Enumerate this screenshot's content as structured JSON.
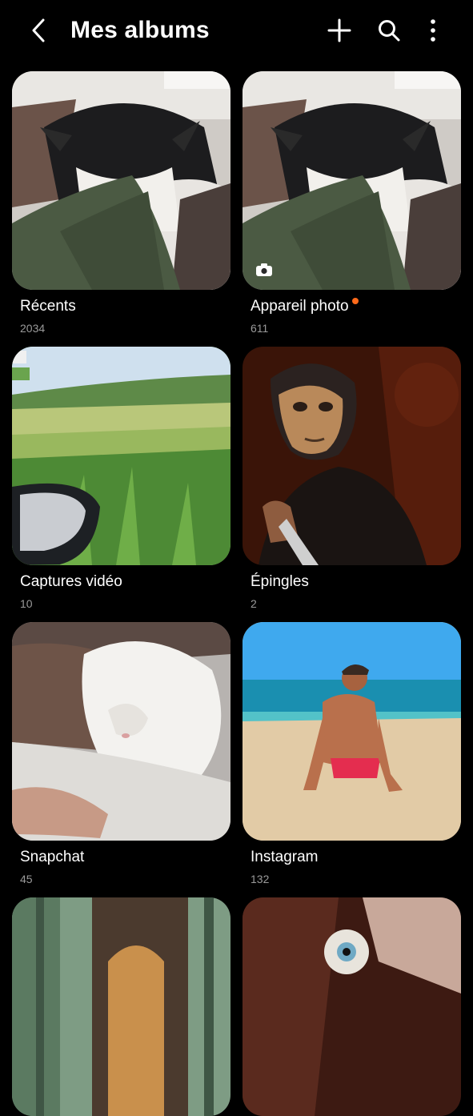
{
  "header": {
    "title": "Mes albums",
    "back_icon": "chevron-left-icon",
    "add_icon": "plus-icon",
    "search_icon": "search-icon",
    "more_icon": "more-vertical-icon"
  },
  "colors": {
    "background": "#000000",
    "text_primary": "#ffffff",
    "text_secondary": "#9a9a9a",
    "new_indicator": "#ff6a1a"
  },
  "albums": [
    {
      "name": "Récents",
      "count": "2034"
    },
    {
      "name": "Appareil photo",
      "count": "611",
      "badge_icon": "camera-icon",
      "has_new_indicator": true
    },
    {
      "name": "Captures vidéo",
      "count": "10"
    },
    {
      "name": "Épingles",
      "count": "2"
    },
    {
      "name": "Snapchat",
      "count": "45"
    },
    {
      "name": "Instagram",
      "count": "132"
    },
    {
      "name": "",
      "count": ""
    },
    {
      "name": "",
      "count": ""
    }
  ]
}
